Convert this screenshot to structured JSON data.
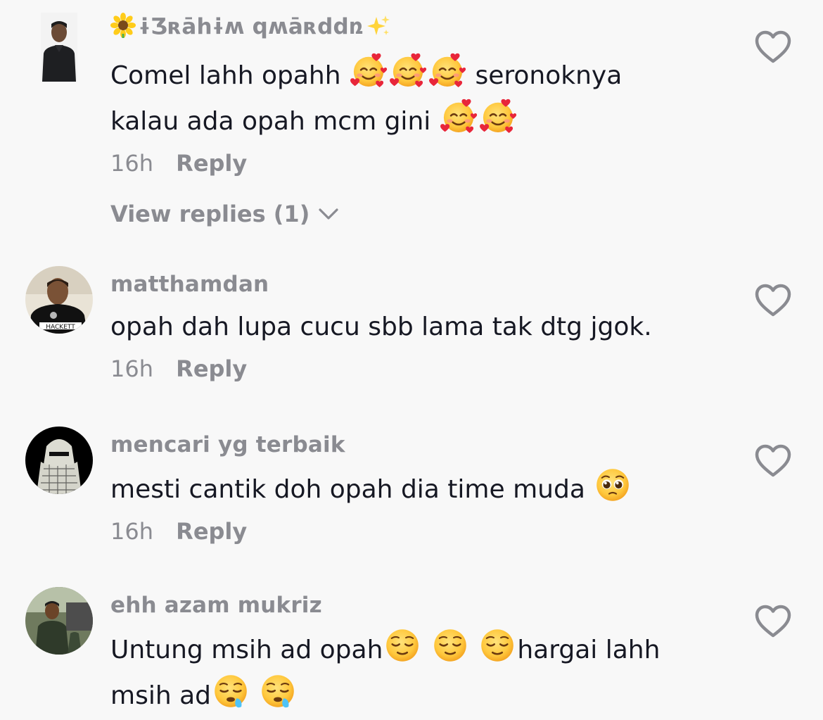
{
  "comments": [
    {
      "username": "ɨƷʀāhɨʍ qʍāʀddռ",
      "username_prefix_icon": "sunflower-icon",
      "username_suffix_icon": "sparkles-icon",
      "text_part1": "Comel lahh opahh",
      "text_part2": "seronoknya",
      "text_part3": "kalau ada opah mcm gini",
      "emoji_icon": "smiling-face-with-hearts-icon",
      "time": "16h",
      "reply": "Reply",
      "view_replies": "View replies (1)"
    },
    {
      "username": "matthamdan",
      "text": "opah dah lupa cucu sbb lama tak dtg jgok.",
      "time": "16h",
      "reply": "Reply"
    },
    {
      "username": "mencari yg terbaik",
      "text": "mesti cantik doh opah dia time muda",
      "emoji_icon": "pleading-face-icon",
      "time": "16h",
      "reply": "Reply"
    },
    {
      "username": "ehh azam mukriz",
      "text_part1": "Untung msih ad opah",
      "text_part2": "hargai lahh",
      "text_part3": "msih ad",
      "emoji_icon_1": "relieved-face-icon",
      "emoji_icon_2": "sleepy-face-icon",
      "partially_visible": true
    }
  ],
  "colors": {
    "background": "#f8f8f8",
    "primary_text": "#161823",
    "secondary_text": "#8a8b91",
    "heart_outline": "#8a8b91"
  }
}
